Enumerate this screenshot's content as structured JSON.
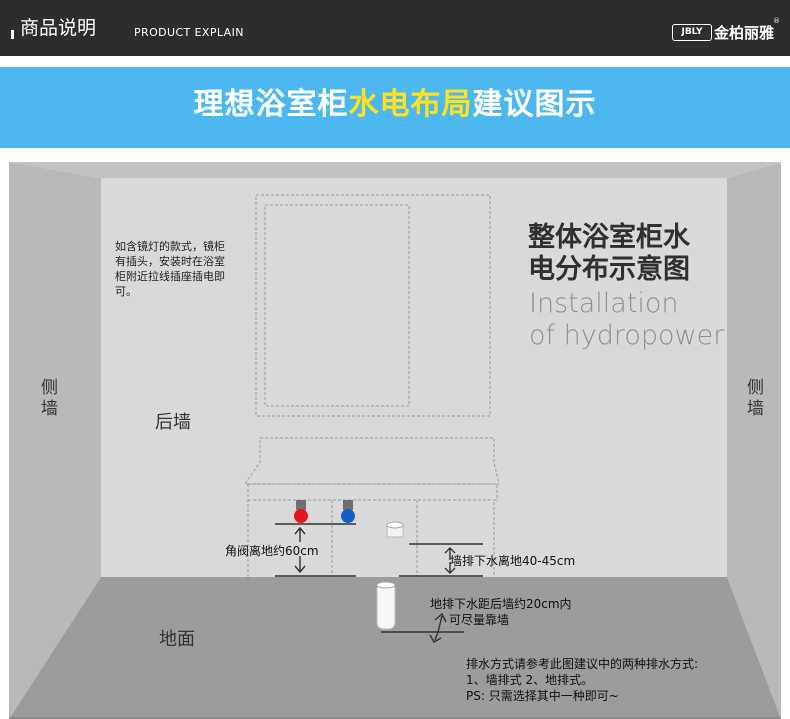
{
  "header": {
    "title": "商品说明",
    "subtitle": "PRODUCT EXPLAIN",
    "brand_logo": "JBLY",
    "brand_name": "金柏丽雅",
    "brand_reg": "®"
  },
  "banner": {
    "text_before": "理想浴室柜",
    "text_highlight": "水电布局",
    "text_after": "建议图示",
    "highlight_color": "#ffe21f",
    "background_color": "#4db8ef"
  },
  "diagram": {
    "heading_line1": "整体浴室柜水",
    "heading_line2": "电分布示意图",
    "heading_en_line1": "Installation",
    "heading_en_line2": "of hydropower",
    "left_wall_label_1": "侧",
    "left_wall_label_2": "墙",
    "right_wall_label_1": "侧",
    "right_wall_label_2": "墙",
    "back_wall_label": "后墙",
    "floor_label": "地面",
    "mirror_note": [
      "如含镜灯的款式，镜柜",
      "有插头，安装时在浴室",
      "柜附近拉线插座插电即",
      "可。"
    ],
    "valve_label": "角阀离地约60cm",
    "wall_drain_label": "墙排下水离地40-45cm",
    "floor_drain_label_1": "地排下水距后墙约20cm内",
    "floor_drain_label_2": "可尽量靠墙",
    "footer_note": [
      "排水方式请参考此图建议中的两种排水方式:",
      "1、墙排式   2、地排式。",
      "PS:  只需选择其中一种即可~"
    ],
    "hot_valve_color": "#e8141b",
    "cold_valve_color": "#1560c8"
  }
}
